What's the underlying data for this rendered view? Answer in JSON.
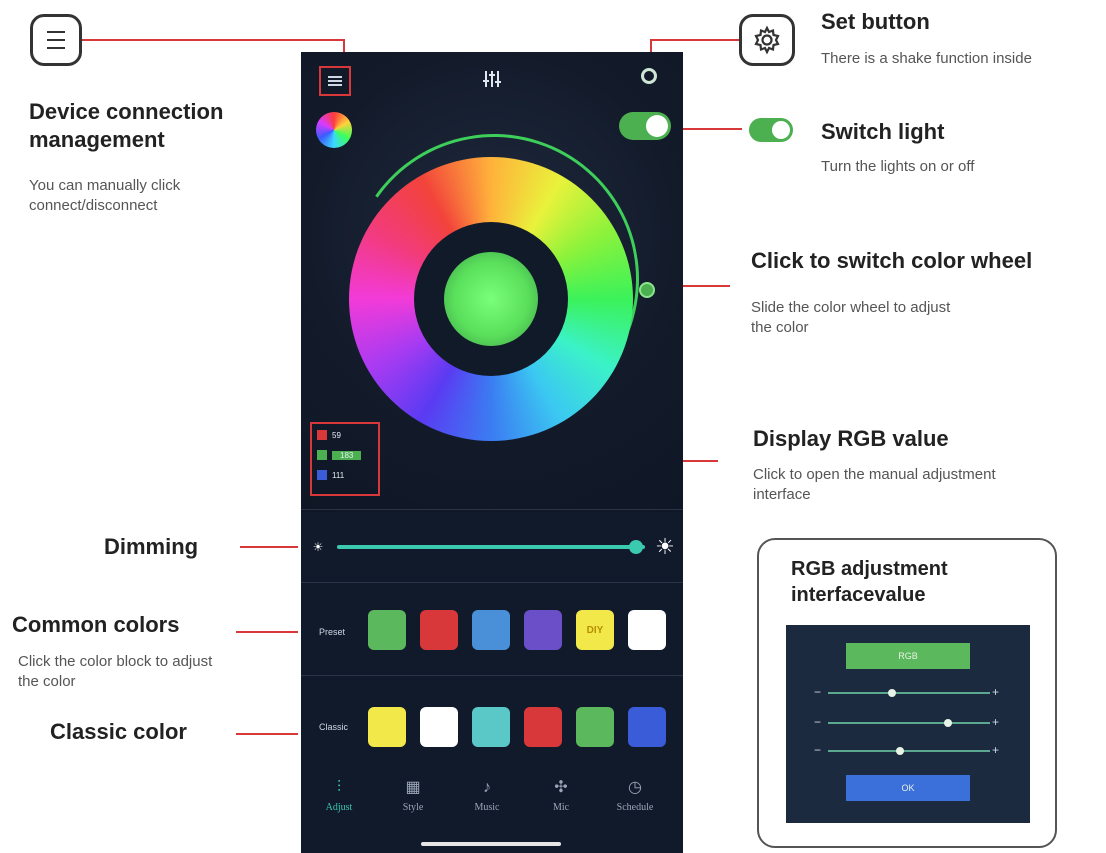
{
  "annotations": {
    "device": {
      "title": "Device connection management",
      "desc": "You can manually click connect/disconnect"
    },
    "set_button": {
      "title": "Set button",
      "desc": "There is a shake function inside"
    },
    "switch_light": {
      "title": "Switch light",
      "desc": "Turn the lights on or off"
    },
    "color_wheel": {
      "title": "Click to switch color wheel",
      "desc": "Slide the color wheel to adjust the color"
    },
    "rgb_value": {
      "title": "Display RGB value",
      "desc": "Click to open the manual adjustment interface"
    },
    "dimming": {
      "title": "Dimming"
    },
    "common_colors": {
      "title": "Common colors",
      "desc": "Click the color block to adjust the color"
    },
    "classic_color": {
      "title": "Classic color"
    },
    "rgb_panel": {
      "title": "RGB adjustment interfacevalue",
      "top_button": "RGB",
      "ok_button": "OK"
    }
  },
  "phone": {
    "rgb": [
      {
        "label": "R",
        "value": "59",
        "color": "#d9383a"
      },
      {
        "label": "G",
        "value": "183",
        "color": "#4caf50"
      },
      {
        "label": "B",
        "value": "111",
        "color": "#3b5cd9"
      }
    ],
    "dimming_level": 0.97,
    "preset_label": "Preset",
    "preset_colors": [
      "#5cb85c",
      "#d9383a",
      "#4a90d9",
      "#6a4fc8",
      "#f2e84a",
      "#ffffff"
    ],
    "preset_diy_text": "DIY",
    "classic_label": "Classic",
    "classic_colors": [
      "#f2e84a",
      "#ffffff",
      "#5bc8c8",
      "#d9383a",
      "#5cb85c",
      "#3b5cd9"
    ],
    "nav": [
      {
        "label": "Adjust",
        "icon": "sliders-icon"
      },
      {
        "label": "Style",
        "icon": "grid-icon"
      },
      {
        "label": "Music",
        "icon": "music-icon"
      },
      {
        "label": "Mic",
        "icon": "mic-icon"
      },
      {
        "label": "Schedule",
        "icon": "clock-icon"
      }
    ]
  },
  "colors": {
    "accent_green": "#4caf50",
    "annotation_red": "#d9383a",
    "phone_bg": "#101a2b",
    "dim_teal": "#3bc9b0"
  }
}
